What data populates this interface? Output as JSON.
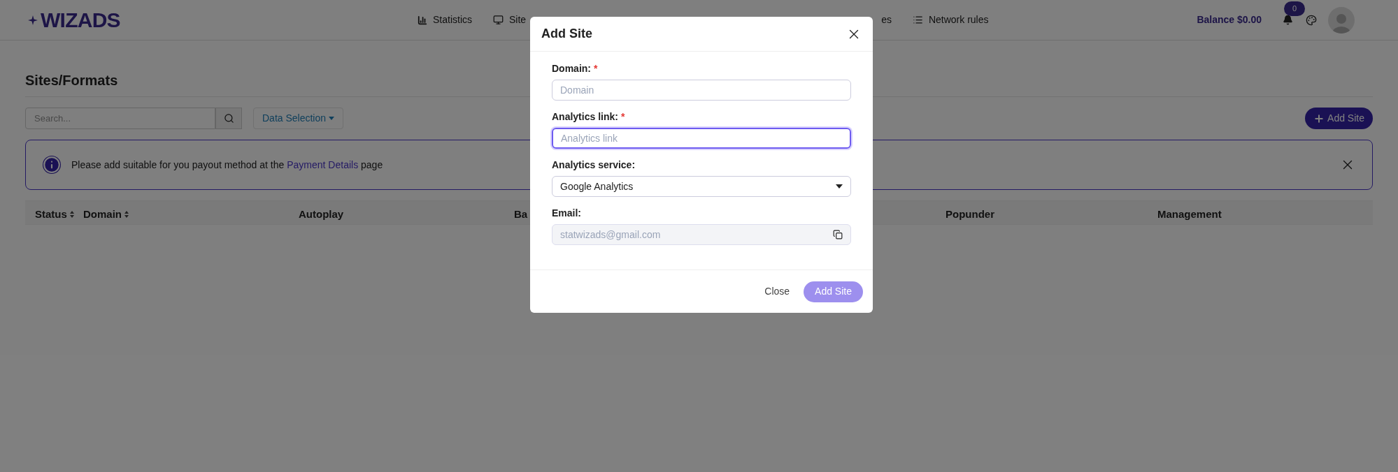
{
  "header": {
    "logo": "WIZADS",
    "nav": [
      {
        "label": "Statistics"
      },
      {
        "label": "Site"
      },
      {
        "label": "es"
      },
      {
        "label": "Network rules"
      }
    ],
    "balance": "Balance $0.00",
    "notifications": "0"
  },
  "page": {
    "title": "Sites/Formats",
    "search": {
      "placeholder": "Search..."
    },
    "data_selection": "Data Selection",
    "add_button": "Add Site",
    "alert": {
      "text": "Please add suitable for you payout method at the ",
      "link": "Payment Details",
      "after": " page"
    },
    "table": {
      "columns": [
        {
          "label": "Status",
          "sortable": true
        },
        {
          "label": "Domain",
          "sortable": true
        },
        {
          "label": "Autoplay",
          "sortable": false
        },
        {
          "label": "Ba",
          "sortable": false
        },
        {
          "label": "Popunder",
          "sortable": false
        },
        {
          "label": "Management",
          "sortable": false
        }
      ]
    }
  },
  "modal": {
    "title": "Add Site",
    "fields": [
      {
        "kind": "input",
        "label": "Domain:",
        "required_mark": "*",
        "placeholder": "Domain",
        "focused": false
      },
      {
        "kind": "input",
        "label": "Analytics link:",
        "required_mark": "*",
        "placeholder": "Analytics link",
        "focused": true
      },
      {
        "kind": "select",
        "label": "Analytics service:",
        "value": "Google Analytics"
      },
      {
        "kind": "copy",
        "label": "Email:",
        "value": "statwizads@gmail.com",
        "disabled": true
      }
    ],
    "close": "Close",
    "submit": {
      "label": "Add Site",
      "disabled": true
    }
  }
}
